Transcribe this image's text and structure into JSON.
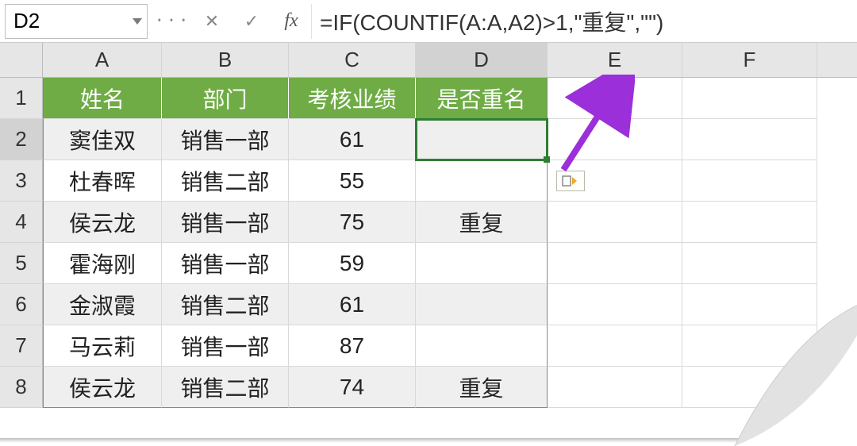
{
  "name_box": "D2",
  "formula": "=IF(COUNTIF(A:A,A2)>1,\"重复\",\"\")",
  "icons": {
    "dots": "᛫᛫᛫",
    "cancel": "✕",
    "enter": "✓",
    "fx": "fx"
  },
  "columns": [
    "A",
    "B",
    "C",
    "D",
    "E",
    "F"
  ],
  "selected_column": "D",
  "rows": [
    "1",
    "2",
    "3",
    "4",
    "5",
    "6",
    "7",
    "8"
  ],
  "selected_row": "2",
  "selected_cell": "D2",
  "header": {
    "A": "姓名",
    "B": "部门",
    "C": "考核业绩",
    "D": "是否重名"
  },
  "data": [
    {
      "A": "窦佳双",
      "B": "销售一部",
      "C": "61",
      "D": ""
    },
    {
      "A": "杜春晖",
      "B": "销售二部",
      "C": "55",
      "D": ""
    },
    {
      "A": "侯云龙",
      "B": "销售一部",
      "C": "75",
      "D": "重复"
    },
    {
      "A": "霍海刚",
      "B": "销售一部",
      "C": "59",
      "D": ""
    },
    {
      "A": "金淑霞",
      "B": "销售二部",
      "C": "61",
      "D": ""
    },
    {
      "A": "马云莉",
      "B": "销售一部",
      "C": "87",
      "D": ""
    },
    {
      "A": "侯云龙",
      "B": "销售二部",
      "C": "74",
      "D": "重复"
    }
  ],
  "colors": {
    "header_bg": "#6fac46",
    "selection": "#2f7d32",
    "arrow": "#9b2fd9"
  },
  "chart_data": {
    "type": "table",
    "columns": [
      "姓名",
      "部门",
      "考核业绩",
      "是否重名"
    ],
    "rows": [
      [
        "窦佳双",
        "销售一部",
        61,
        ""
      ],
      [
        "杜春晖",
        "销售二部",
        55,
        ""
      ],
      [
        "侯云龙",
        "销售一部",
        75,
        "重复"
      ],
      [
        "霍海刚",
        "销售一部",
        59,
        ""
      ],
      [
        "金淑霞",
        "销售二部",
        61,
        ""
      ],
      [
        "马云莉",
        "销售一部",
        87,
        ""
      ],
      [
        "侯云龙",
        "销售二部",
        74,
        "重复"
      ]
    ]
  }
}
